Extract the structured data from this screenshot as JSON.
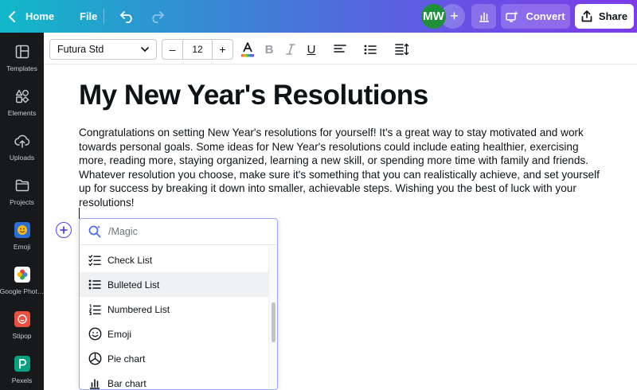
{
  "topbar": {
    "home_label": "Home",
    "file_label": "File",
    "avatar_initials": "MW",
    "avatar_color": "#1f8f3a",
    "add_label": "+",
    "convert_label": "Convert",
    "share_label": "Share",
    "gradient_colors": [
      "#11b8c9",
      "#3f7fd6",
      "#6a4ee6",
      "#7d3ce8"
    ]
  },
  "sidebar": {
    "items": [
      {
        "label": "Templates",
        "icon": "templates-icon"
      },
      {
        "label": "Elements",
        "icon": "elements-icon"
      },
      {
        "label": "Uploads",
        "icon": "upload-cloud-icon"
      },
      {
        "label": "Projects",
        "icon": "folder-icon"
      },
      {
        "label": "Emoji",
        "icon": "emoji-app-icon"
      },
      {
        "label": "Google Phot…",
        "icon": "google-photos-icon"
      },
      {
        "label": "Stipop",
        "icon": "stipop-icon"
      },
      {
        "label": "Pexels",
        "icon": "pexels-icon"
      }
    ]
  },
  "toolbar": {
    "font_family": "Futura Std",
    "minus_label": "–",
    "font_size": "12",
    "plus_label": "+",
    "text_color_letter": "A",
    "bold_label": "B",
    "underline_label": "U"
  },
  "document": {
    "title": "My New Year's Resolutions",
    "body": "Congratulations on setting New Year's resolutions for yourself! It's a great way to stay motivated and work towards personal goals. Some ideas for New Year's resolutions could include eating healthier, exercising more, reading more, staying organized, learning a new skill, or spending more time with family and friends. Whatever resolution you choose, make sure it's something that you can realistically achieve, and set yourself up for success by breaking it down into smaller, achievable steps. Wishing you the best of luck with your resolutions!"
  },
  "magic_menu": {
    "search_value": "/Magic",
    "items": [
      {
        "label": "Check List",
        "icon": "checklist-icon"
      },
      {
        "label": "Bulleted List",
        "icon": "bulleted-list-icon",
        "highlighted": true
      },
      {
        "label": "Numbered List",
        "icon": "numbered-list-icon"
      },
      {
        "label": "Emoji",
        "icon": "smiley-icon"
      },
      {
        "label": "Pie chart",
        "icon": "pie-chart-icon"
      },
      {
        "label": "Bar chart",
        "icon": "bar-chart-icon"
      }
    ]
  }
}
